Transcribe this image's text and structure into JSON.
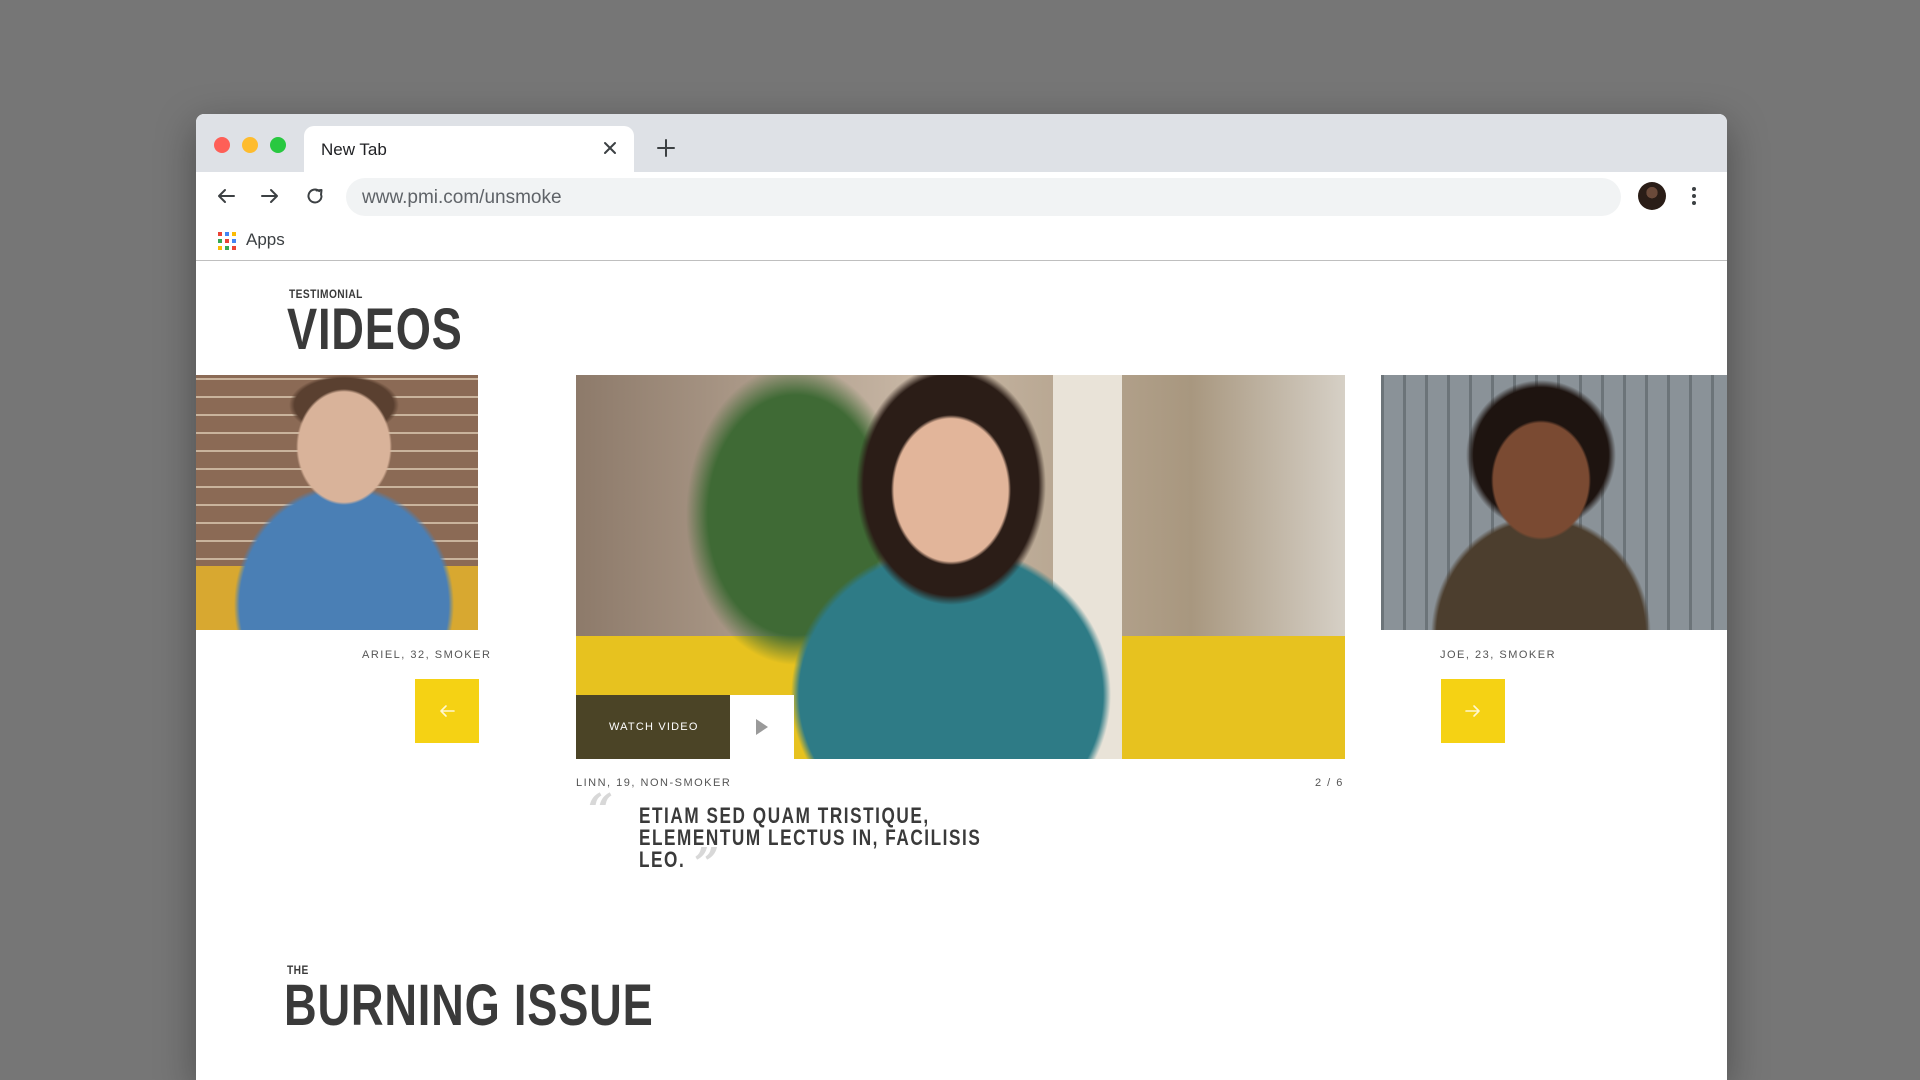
{
  "browser": {
    "tab_title": "New Tab",
    "url": "www.pmi.com/unsmoke",
    "bookmarks_apps_label": "Apps"
  },
  "videos_section": {
    "eyebrow": "TESTIMONIAL",
    "title": "VIDEOS",
    "left_caption": "ARIEL, 32, SMOKER",
    "center_caption": "LINN, 19, NON-SMOKER",
    "right_caption": "JOE, 23, SMOKER",
    "counter": "2 / 6",
    "watch_video_label": "WATCH VIDEO",
    "quote_lines": [
      "ETIAM SED QUAM TRISTIQUE,",
      "ELEMENTUM LECTUS IN, FACILISIS",
      "LEO."
    ],
    "open_quote": "“",
    "close_quote": "”"
  },
  "burning_section": {
    "eyebrow": "THE",
    "title": "BURNING ISSUE"
  },
  "icons": {
    "prev": "arrow-left-icon",
    "next": "arrow-right-icon",
    "play": "play-icon",
    "close": "close-icon",
    "new_tab": "plus-icon",
    "back": "back-arrow-icon",
    "forward": "forward-arrow-icon",
    "reload": "reload-icon",
    "menu": "kebab-menu-icon",
    "apps": "apps-grid-icon"
  },
  "colors": {
    "accent_yellow": "#f5d214",
    "background": "#767676",
    "heading_text": "#3a3a3a"
  }
}
